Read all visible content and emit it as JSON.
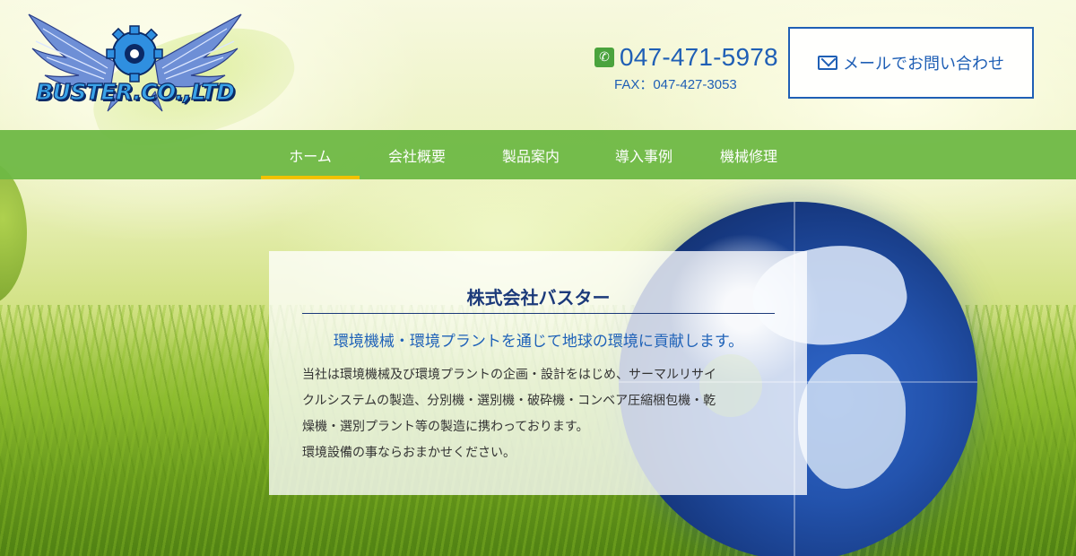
{
  "logo": {
    "text": "BUSTER.CO.,LTD"
  },
  "contact": {
    "phone": "047-471-5978",
    "fax": "FAX：047-427-3053",
    "mail_button": "メールでお問い合わせ"
  },
  "nav": {
    "items": [
      {
        "label": "ホーム",
        "active": true
      },
      {
        "label": "会社概要",
        "active": false
      },
      {
        "label": "製品案内",
        "active": false
      },
      {
        "label": "導入事例",
        "active": false
      },
      {
        "label": "機械修理",
        "active": false
      }
    ]
  },
  "hero": {
    "title": "株式会社バスター",
    "subtitle": "環境機械・環境プラントを通じて地球の環境に貢献します。",
    "body_lines": [
      "当社は環境機械及び環境プラントの企画・設計をはじめ、サーマルリサイ",
      "クルシステムの製造、分別機・選別機・破砕機・コンベア圧縮梱包機・乾",
      "燥機・選別プラント等の製造に携わっております。",
      "環境設備の事ならおまかせください。"
    ]
  },
  "colors": {
    "brand_blue": "#1f5fb5",
    "nav_green": "#6eb844",
    "nav_active_underline": "#f2c200",
    "phone_icon_green": "#4aa33d"
  },
  "icons": {
    "phone": "phone-icon",
    "mail": "mail-icon",
    "logo": "winged-gear-logo-icon"
  }
}
